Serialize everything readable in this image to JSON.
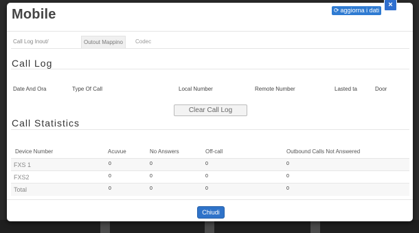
{
  "modal": {
    "title": "Mobile",
    "refresh_label": "aggiorna i dati",
    "close_icon": "×"
  },
  "tabs": [
    {
      "label": "Call Log Inout/Outout Mappino"
    },
    {
      "label": "Call Log Inout/Outout Mappino"
    },
    {
      "label": "Codec"
    }
  ],
  "tabs_display": {
    "t1": "Call Log Inout/",
    "t2": "Outout Mappino",
    "t3": "Codec"
  },
  "call_log": {
    "title": "Call Log",
    "columns": [
      "Date And Ora",
      "Type Of Call",
      "Local Number",
      "Remote Number",
      "Lasted ta",
      "Door"
    ],
    "clear_label": "Clear Call Log"
  },
  "call_statistics": {
    "title": "Call Statistics",
    "columns": [
      "Device Number",
      "Acuvue",
      "No Answers",
      "Off-call",
      "Outbound Calls Not Answered"
    ],
    "rows": [
      {
        "device": "FXS 1",
        "values": [
          "0",
          "0",
          "0",
          "0"
        ]
      },
      {
        "device": "FXS2",
        "values": [
          "0",
          "0",
          "0",
          "0"
        ]
      },
      {
        "device": "Total",
        "values": [
          "0",
          "0",
          "0",
          "0"
        ]
      }
    ]
  },
  "footer": {
    "close_label": "Chiudi"
  }
}
